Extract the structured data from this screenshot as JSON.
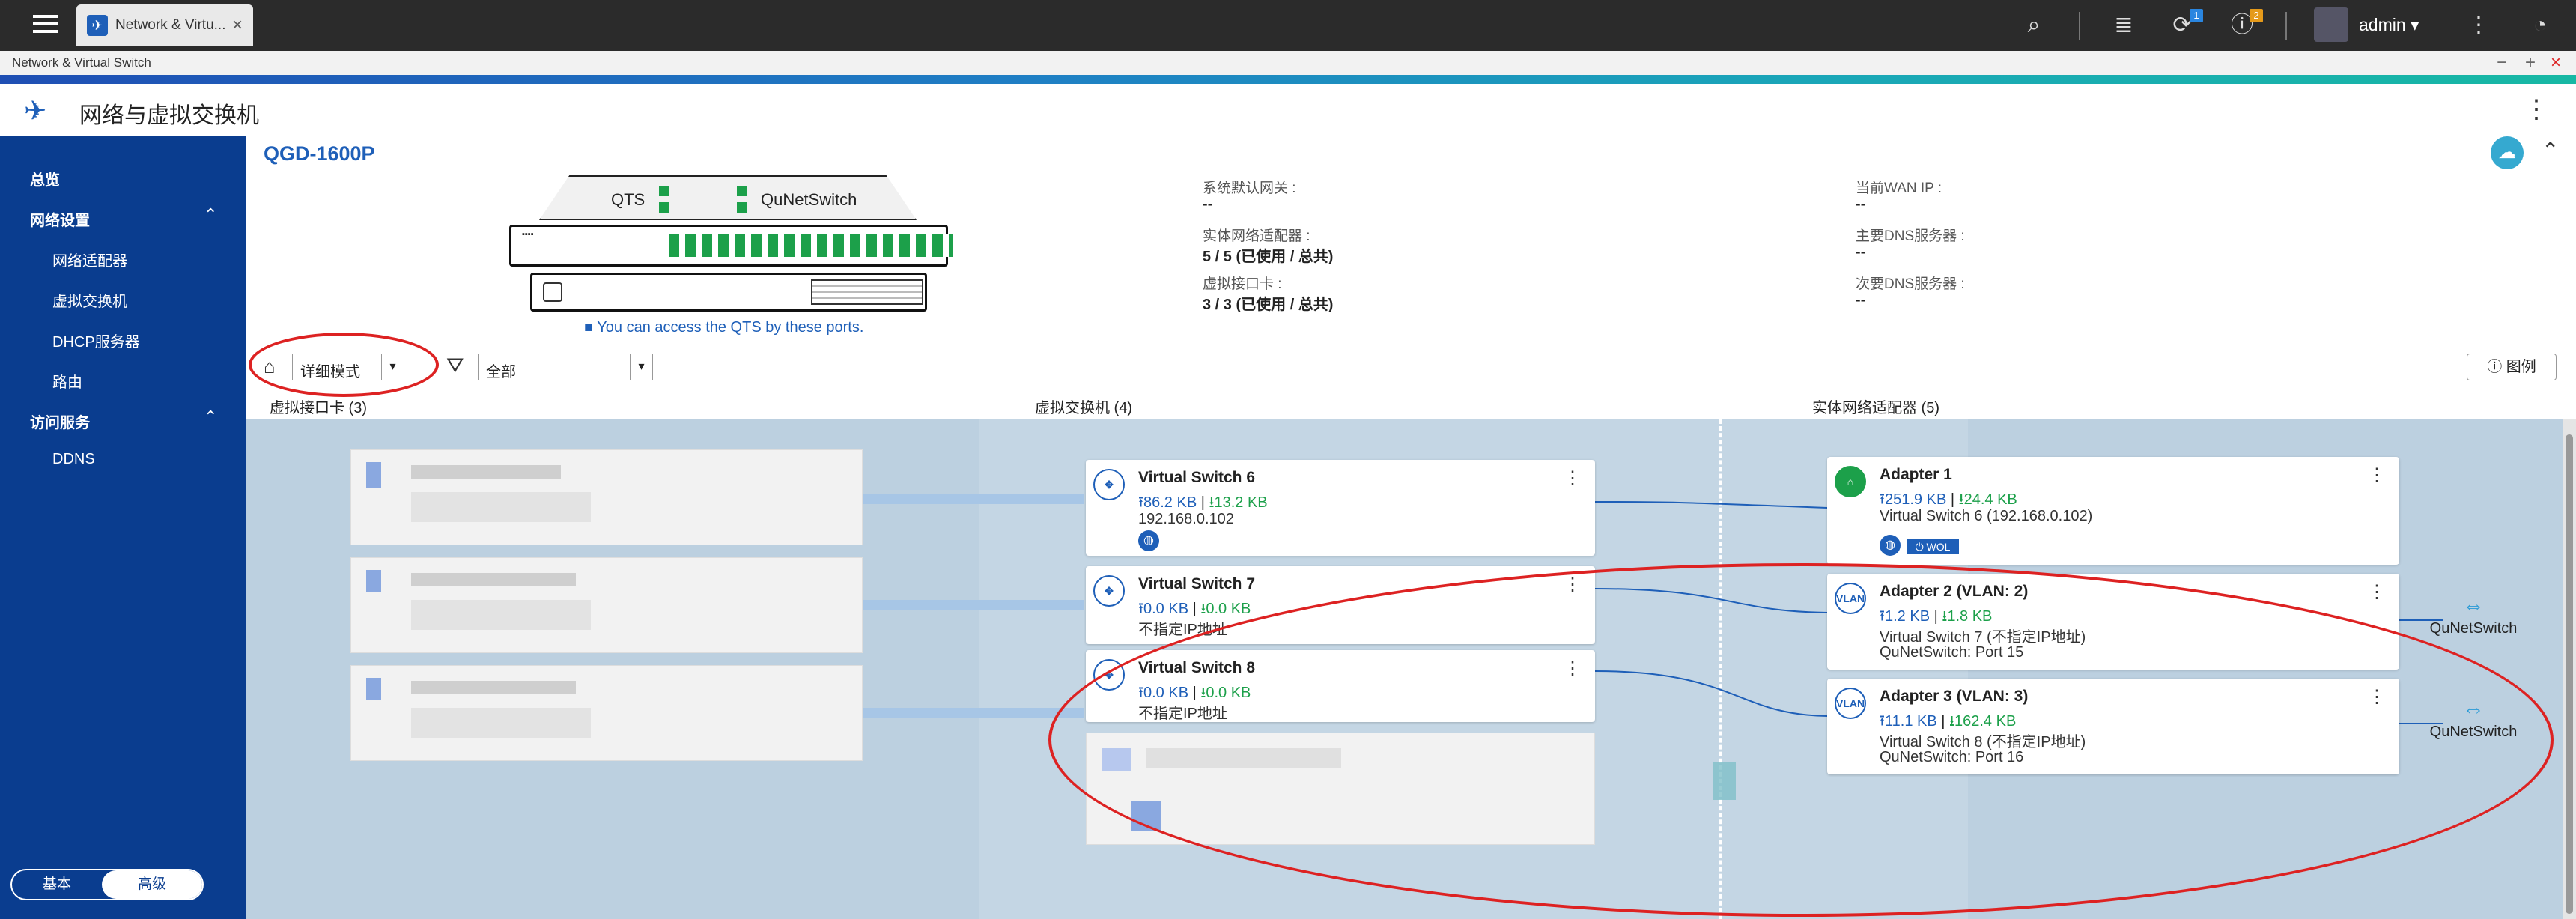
{
  "topbar": {
    "tab_label": "Network & Virtu...",
    "tab_close": "×",
    "user": "admin ▾",
    "badge_1": "1",
    "badge_2": "2",
    "icons": [
      "search-icon",
      "stack-icon",
      "sync-icon",
      "info-icon",
      "more-icon",
      "gauge-icon"
    ]
  },
  "window": {
    "title": "Network & Virtual Switch",
    "minimize": "−",
    "maximize": "+",
    "close": "×"
  },
  "header": {
    "title": "网络与虚拟交换机",
    "more": "⋮"
  },
  "sidebar": {
    "overview": "总览",
    "network_settings": "网络设置",
    "network_adapter": "网络适配器",
    "virtual_switch": "虚拟交换机",
    "dhcp": "DHCP服务器",
    "routing": "路由",
    "access_services": "访问服务",
    "ddns": "DDNS",
    "mode_basic": "基本",
    "mode_advanced": "高级"
  },
  "device": {
    "name": "QGD-1600P",
    "qts_label": "QTS",
    "qns_label": "QuNetSwitch",
    "access_note": "■ You can access the QTS by these ports.",
    "info": {
      "gateway_label": "系统默认网关 :",
      "gateway_value": "--",
      "adapters_label": "实体网络适配器 :",
      "adapters_value": "5 / 5 (已使用 / 总共)",
      "vnic_label": "虚拟接口卡 :",
      "vnic_value": "3 / 3 (已使用 / 总共)",
      "wan_label": "当前WAN IP :",
      "wan_value": "--",
      "dns1_label": "主要DNS服务器 :",
      "dns1_value": "--",
      "dns2_label": "次要DNS服务器 :",
      "dns2_value": "--"
    }
  },
  "filters": {
    "view_mode": "详细模式",
    "filter_value": "全部",
    "legend": "ⓘ 图例"
  },
  "columns": {
    "vnic": "虚拟接口卡 (3)",
    "vswitch": "虚拟交换机 (4)",
    "adapter": "实体网络适配器 (5)"
  },
  "switches": [
    {
      "name": "Virtual Switch 6",
      "up": "⭱86.2 KB",
      "down": "⭳13.2 KB",
      "line3": "192.168.0.102"
    },
    {
      "name": "Virtual Switch 7",
      "up": "⭱0.0 KB",
      "down": "⭳0.0 KB",
      "line3": "不指定IP地址"
    },
    {
      "name": "Virtual Switch 8",
      "up": "⭱0.0 KB",
      "down": "⭳0.0 KB",
      "line3": "不指定IP地址"
    }
  ],
  "adapters": [
    {
      "name": "Adapter 1",
      "up": "⭱251.9 KB",
      "down": "⭳24.4 KB",
      "line3": "Virtual Switch 6 (192.168.0.102)",
      "wol": "⏻ WOL"
    },
    {
      "name": "Adapter 2 (VLAN: 2)",
      "up": "⭱1.2 KB",
      "down": "⭳1.8 KB",
      "line3": "Virtual Switch 7 (不指定IP地址)",
      "line4": "QuNetSwitch: Port 15"
    },
    {
      "name": "Adapter 3 (VLAN: 3)",
      "up": "⭱11.1 KB",
      "down": "⭳162.4 KB",
      "line3": "Virtual Switch 8 (不指定IP地址)",
      "line4": "QuNetSwitch: Port 16"
    }
  ],
  "qnswitch_label": "QuNetSwitch",
  "vlan_icon": "VLAN",
  "colors": {
    "brand": "#1e5fb8",
    "sidebar": "#0a3d8f",
    "annotation": "#dd2222",
    "port_green": "#1ca04a"
  }
}
